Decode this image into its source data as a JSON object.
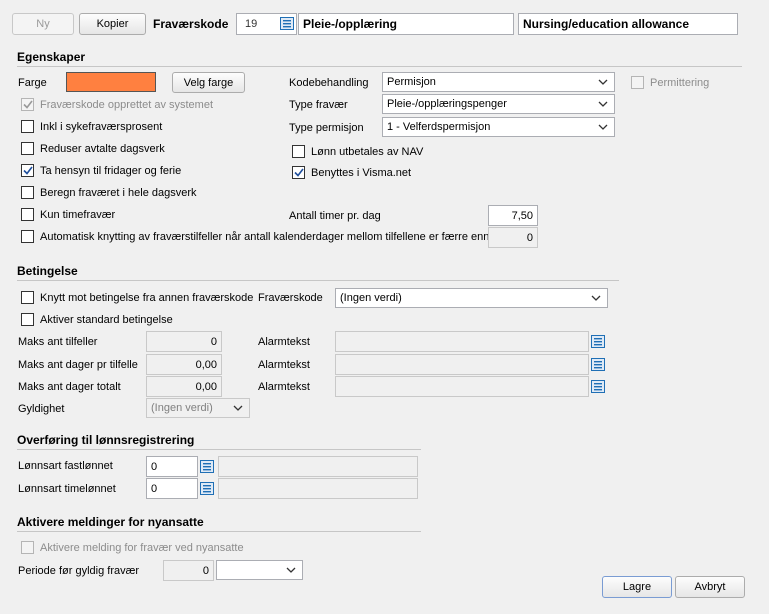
{
  "toolbar": {
    "new_label": "Ny",
    "copy_label": "Kopier",
    "code_label": "Fraværskode",
    "code_value": "19",
    "name_no": "Pleie-/opplæring",
    "name_en": "Nursing/education allowance"
  },
  "properties": {
    "title": "Egenskaper",
    "color_label": "Farge",
    "color_value": "#ff8040",
    "choose_color_label": "Velg farge",
    "created_by_system": {
      "label": "Fraværskode opprettet av systemet",
      "checked": true,
      "enabled": false
    },
    "include_sick_pct": {
      "label": "Inkl i sykefraværsprosent",
      "checked": false
    },
    "reduce_workdays": {
      "label": "Reduser avtalte dagsverk",
      "checked": false
    },
    "consider_holidays": {
      "label": "Ta hensyn til fridager og ferie",
      "checked": true
    },
    "calc_whole_day": {
      "label": "Beregn fraværet i hele dagsverk",
      "checked": false
    },
    "hours_only": {
      "label": "Kun timefravær",
      "checked": false
    },
    "auto_link": {
      "label": "Automatisk knytting av fraværstilfeller når antall kalenderdager mellom tilfellene er færre enn",
      "checked": false,
      "value": "0"
    },
    "code_handling_label": "Kodebehandling",
    "code_handling_value": "Permisjon",
    "absence_type_label": "Type fravær",
    "absence_type_value": "Pleie-/opplæringspenger",
    "leave_type_label": "Type permisjon",
    "leave_type_value": "1 - Velferdspermisjon",
    "nav_pays": {
      "label": "Lønn utbetales av NAV",
      "checked": false
    },
    "visma_net": {
      "label": "Benyttes i Visma.net",
      "checked": true
    },
    "layoff": {
      "label": "Permittering",
      "checked": false,
      "enabled": false
    },
    "hours_per_day_label": "Antall timer pr. dag",
    "hours_per_day_value": "7,50"
  },
  "condition": {
    "title": "Betingelse",
    "link_other": {
      "label": "Knytt mot betingelse fra annen fraværskode",
      "checked": false
    },
    "absence_code_label": "Fraværskode",
    "absence_code_value": "(Ingen verdi)",
    "activate_std": {
      "label": "Aktiver standard betingelse",
      "checked": false
    },
    "max_cases_label": "Maks ant tilfeller",
    "max_cases_value": "0",
    "max_days_case_label": "Maks ant dager pr tilfelle",
    "max_days_case_value": "0,00",
    "max_days_total_label": "Maks ant dager totalt",
    "max_days_total_value": "0,00",
    "alarm_label": "Alarmtekst",
    "validity_label": "Gyldighet",
    "validity_value": "(Ingen verdi)"
  },
  "payroll": {
    "title": "Overføring til lønnsregistrering",
    "fixed_label": "Lønnsart fastlønnet",
    "fixed_value": "0",
    "hourly_label": "Lønnsart timelønnet",
    "hourly_value": "0"
  },
  "messages": {
    "title": "Aktivere meldinger for nyansatte",
    "activate": {
      "label": "Aktivere melding for fravær ved nyansatte",
      "checked": false,
      "enabled": false
    },
    "period_label": "Periode før gyldig fravær",
    "period_value": "0",
    "period_unit_value": ""
  },
  "footer": {
    "save_label": "Lagre",
    "cancel_label": "Avbryt"
  },
  "icons": {
    "lookup": "list-lookup-icon",
    "chevron": "chevron-down-icon",
    "check": "checkmark-icon"
  },
  "colors": {
    "lookup_icon": "#1f6fb5",
    "swatch": "#ff8040"
  }
}
